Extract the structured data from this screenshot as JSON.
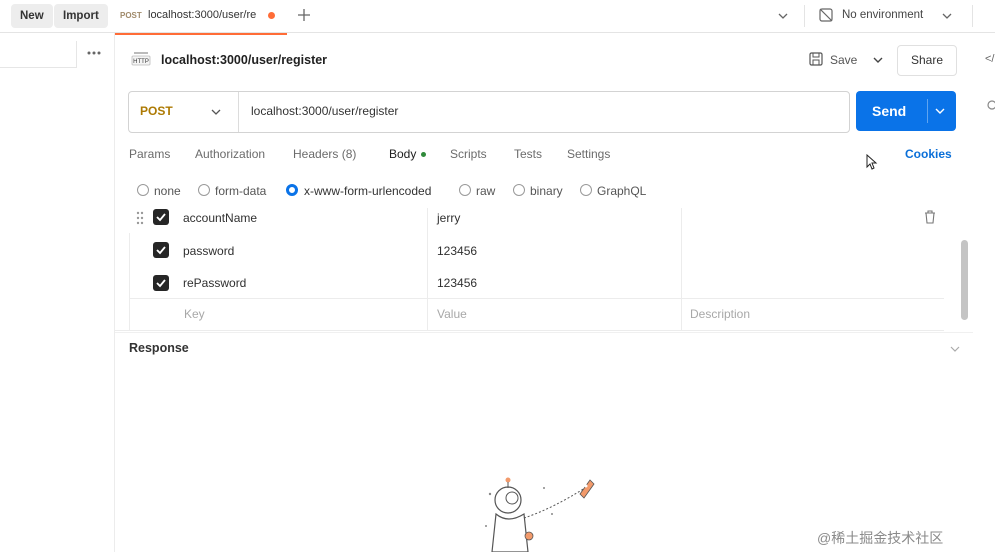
{
  "topbar": {
    "new_label": "New",
    "import_label": "Import",
    "tab_method": "POST",
    "tab_url": "localhost:3000/user/re",
    "environment": "No environment"
  },
  "request": {
    "icon_text": "HTTP",
    "title": "localhost:3000/user/register",
    "save_label": "Save",
    "share_label": "Share",
    "method": "POST",
    "url": "localhost:3000/user/register",
    "send_label": "Send"
  },
  "request_tabs": {
    "params": "Params",
    "authorization": "Authorization",
    "headers": "Headers (8)",
    "body": "Body",
    "scripts": "Scripts",
    "tests": "Tests",
    "settings": "Settings",
    "cookies": "Cookies"
  },
  "body_types": {
    "none": "none",
    "form_data": "form-data",
    "urlencoded": "x-www-form-urlencoded",
    "raw": "raw",
    "binary": "binary",
    "graphql": "GraphQL"
  },
  "params": {
    "rows": [
      {
        "key": "accountName",
        "value": "jerry",
        "checked": true
      },
      {
        "key": "password",
        "value": "123456",
        "checked": true
      },
      {
        "key": "rePassword",
        "value": "123456",
        "checked": true
      }
    ],
    "placeholder_key": "Key",
    "placeholder_value": "Value",
    "placeholder_description": "Description"
  },
  "response": {
    "title": "Response"
  },
  "watermark": "@稀土掘金技术社区",
  "colors": {
    "accent": "#0a73e8",
    "tab_indicator": "#ff6c37",
    "cookies_link": "#0a6fd8"
  }
}
